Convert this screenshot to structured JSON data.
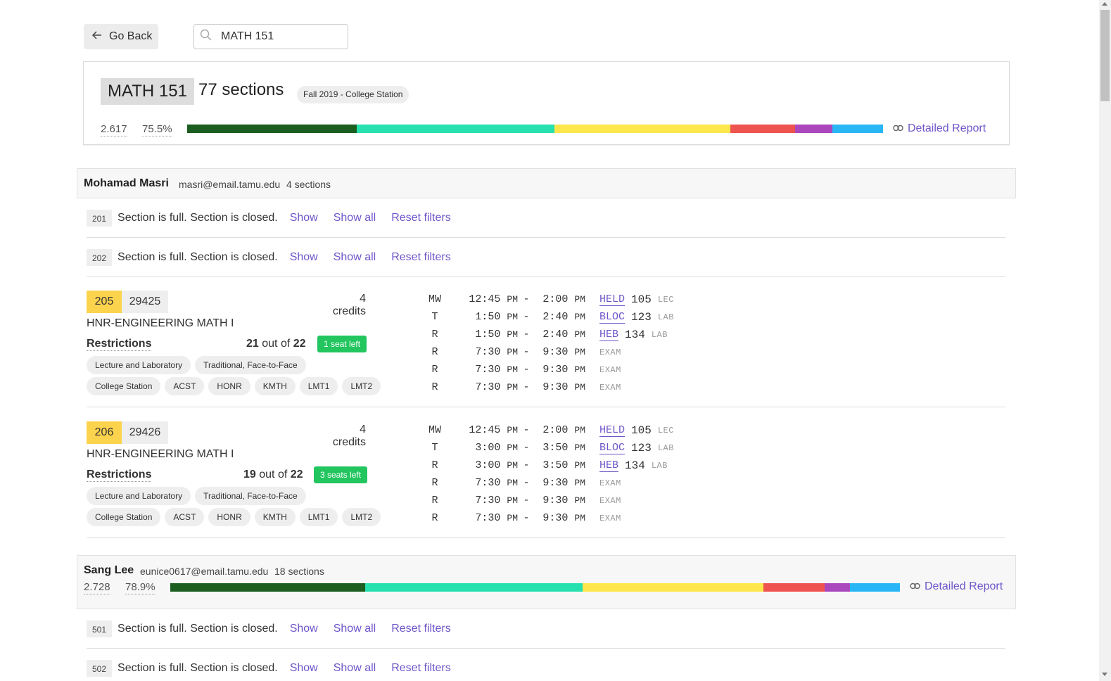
{
  "nav": {
    "back_label": "Go Back",
    "search_value": "MATH 151"
  },
  "course": {
    "code": "MATH 151",
    "section_count": "77 sections",
    "term": "Fall 2019 - College Station",
    "gpa": "2.617",
    "pass_rate": "75.5%",
    "grade_distribution": [
      {
        "grade": "A",
        "fraction": 0.244,
        "color": "#1b5e20"
      },
      {
        "grade": "B",
        "fraction": 0.284,
        "color": "#26e0b0"
      },
      {
        "grade": "C",
        "fraction": 0.253,
        "color": "#fde74c"
      },
      {
        "grade": "D",
        "fraction": 0.093,
        "color": "#ef5350"
      },
      {
        "grade": "F",
        "fraction": 0.053,
        "color": "#ab47bc"
      },
      {
        "grade": "Q",
        "fraction": 0.073,
        "color": "#29b6f6"
      }
    ],
    "detail_label": "Detailed Report"
  },
  "professors": [
    {
      "name": "Mohamad Masri",
      "email": "masri@email.tamu.edu",
      "sections": "4 sections",
      "closed_sections": [
        {
          "number": "201",
          "text": "Section is full. Section is closed.",
          "show": "Show",
          "show_all": "Show all",
          "reset": "Reset filters"
        },
        {
          "number": "202",
          "text": "Section is full. Section is closed.",
          "show": "Show",
          "show_all": "Show all",
          "reset": "Reset filters"
        }
      ],
      "open_sections": [
        {
          "number": "205",
          "crn": "29425",
          "credits": "4 credits",
          "title": "HNR-ENGINEERING MATH I",
          "restrictions": "Restrictions",
          "enrolled": "21",
          "out_of": "out of",
          "capacity": "22",
          "seats_badge": "1 seat left",
          "tags_row1": [
            "Lecture and Laboratory",
            "Traditional, Face-to-Face"
          ],
          "tags_row2": [
            "College Station",
            "ACST",
            "HONR",
            "KMTH",
            "LMT1",
            "LMT2"
          ],
          "meetings": [
            {
              "days": "MW",
              "start": "12:45",
              "start_ampm": "PM",
              "end": "2:00",
              "end_ampm": "PM",
              "bldg": "HELD",
              "room": "105",
              "type": "LEC"
            },
            {
              "days": "T",
              "start": "1:50",
              "start_ampm": "PM",
              "end": "2:40",
              "end_ampm": "PM",
              "bldg": "BLOC",
              "room": "123",
              "type": "LAB"
            },
            {
              "days": "R",
              "start": "1:50",
              "start_ampm": "PM",
              "end": "2:40",
              "end_ampm": "PM",
              "bldg": "HEB",
              "room": "134",
              "type": "LAB"
            },
            {
              "days": "R",
              "start": "7:30",
              "start_ampm": "PM",
              "end": "9:30",
              "end_ampm": "PM",
              "type": "EXAM"
            },
            {
              "days": "R",
              "start": "7:30",
              "start_ampm": "PM",
              "end": "9:30",
              "end_ampm": "PM",
              "type": "EXAM"
            },
            {
              "days": "R",
              "start": "7:30",
              "start_ampm": "PM",
              "end": "9:30",
              "end_ampm": "PM",
              "type": "EXAM"
            }
          ]
        },
        {
          "number": "206",
          "crn": "29426",
          "credits": "4 credits",
          "title": "HNR-ENGINEERING MATH I",
          "restrictions": "Restrictions",
          "enrolled": "19",
          "out_of": "out of",
          "capacity": "22",
          "seats_badge": "3 seats left",
          "tags_row1": [
            "Lecture and Laboratory",
            "Traditional, Face-to-Face"
          ],
          "tags_row2": [
            "College Station",
            "ACST",
            "HONR",
            "KMTH",
            "LMT1",
            "LMT2"
          ],
          "meetings": [
            {
              "days": "MW",
              "start": "12:45",
              "start_ampm": "PM",
              "end": "2:00",
              "end_ampm": "PM",
              "bldg": "HELD",
              "room": "105",
              "type": "LEC"
            },
            {
              "days": "T",
              "start": "3:00",
              "start_ampm": "PM",
              "end": "3:50",
              "end_ampm": "PM",
              "bldg": "BLOC",
              "room": "123",
              "type": "LAB"
            },
            {
              "days": "R",
              "start": "3:00",
              "start_ampm": "PM",
              "end": "3:50",
              "end_ampm": "PM",
              "bldg": "HEB",
              "room": "134",
              "type": "LAB"
            },
            {
              "days": "R",
              "start": "7:30",
              "start_ampm": "PM",
              "end": "9:30",
              "end_ampm": "PM",
              "type": "EXAM"
            },
            {
              "days": "R",
              "start": "7:30",
              "start_ampm": "PM",
              "end": "9:30",
              "end_ampm": "PM",
              "type": "EXAM"
            },
            {
              "days": "R",
              "start": "7:30",
              "start_ampm": "PM",
              "end": "9:30",
              "end_ampm": "PM",
              "type": "EXAM"
            }
          ]
        }
      ]
    },
    {
      "name": "Sang Lee",
      "email": "eunice0617@email.tamu.edu",
      "sections": "18 sections",
      "gpa": "2.728",
      "pass_rate": "78.9%",
      "grade_distribution": [
        {
          "grade": "A",
          "fraction": 0.267,
          "color": "#1b5e20"
        },
        {
          "grade": "B",
          "fraction": 0.298,
          "color": "#26e0b0"
        },
        {
          "grade": "C",
          "fraction": 0.248,
          "color": "#fde74c"
        },
        {
          "grade": "D",
          "fraction": 0.084,
          "color": "#ef5350"
        },
        {
          "grade": "F",
          "fraction": 0.035,
          "color": "#ab47bc"
        },
        {
          "grade": "Q",
          "fraction": 0.068,
          "color": "#29b6f6"
        }
      ],
      "detail_label": "Detailed Report",
      "closed_sections": [
        {
          "number": "501",
          "text": "Section is full. Section is closed.",
          "show": "Show",
          "show_all": "Show all",
          "reset": "Reset filters"
        },
        {
          "number": "502",
          "text": "Section is full. Section is closed.",
          "show": "Show",
          "show_all": "Show all",
          "reset": "Reset filters"
        }
      ]
    }
  ]
}
